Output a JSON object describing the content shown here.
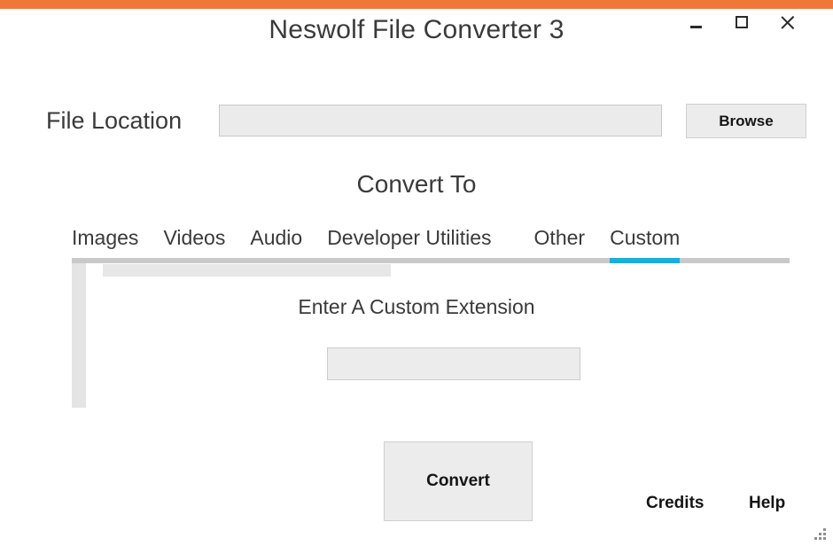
{
  "window": {
    "title": "Neswolf File Converter 3",
    "accent_color": "#ef7839",
    "controls": {
      "minimize": "minimize-icon",
      "maximize": "maximize-icon",
      "close": "close-icon"
    }
  },
  "file_location": {
    "label": "File Location",
    "value": "",
    "placeholder": "",
    "browse_label": "Browse"
  },
  "convert_section": {
    "heading": "Convert To",
    "tabs": [
      {
        "label": "Images",
        "active": false
      },
      {
        "label": "Videos",
        "active": false
      },
      {
        "label": "Audio",
        "active": false
      },
      {
        "label": "Developer Utilities",
        "active": false
      },
      {
        "label": "Other",
        "active": false
      },
      {
        "label": "Custom",
        "active": true
      }
    ],
    "active_tab": "Custom",
    "indicator_color": "#1aaedd",
    "track_color": "#c9c9c9"
  },
  "custom_panel": {
    "label": "Enter A Custom Extension",
    "value": "",
    "placeholder": ""
  },
  "actions": {
    "convert_label": "Convert"
  },
  "footer": {
    "credits_label": "Credits",
    "help_label": "Help",
    "resize_grip": "resize-grip-icon"
  }
}
